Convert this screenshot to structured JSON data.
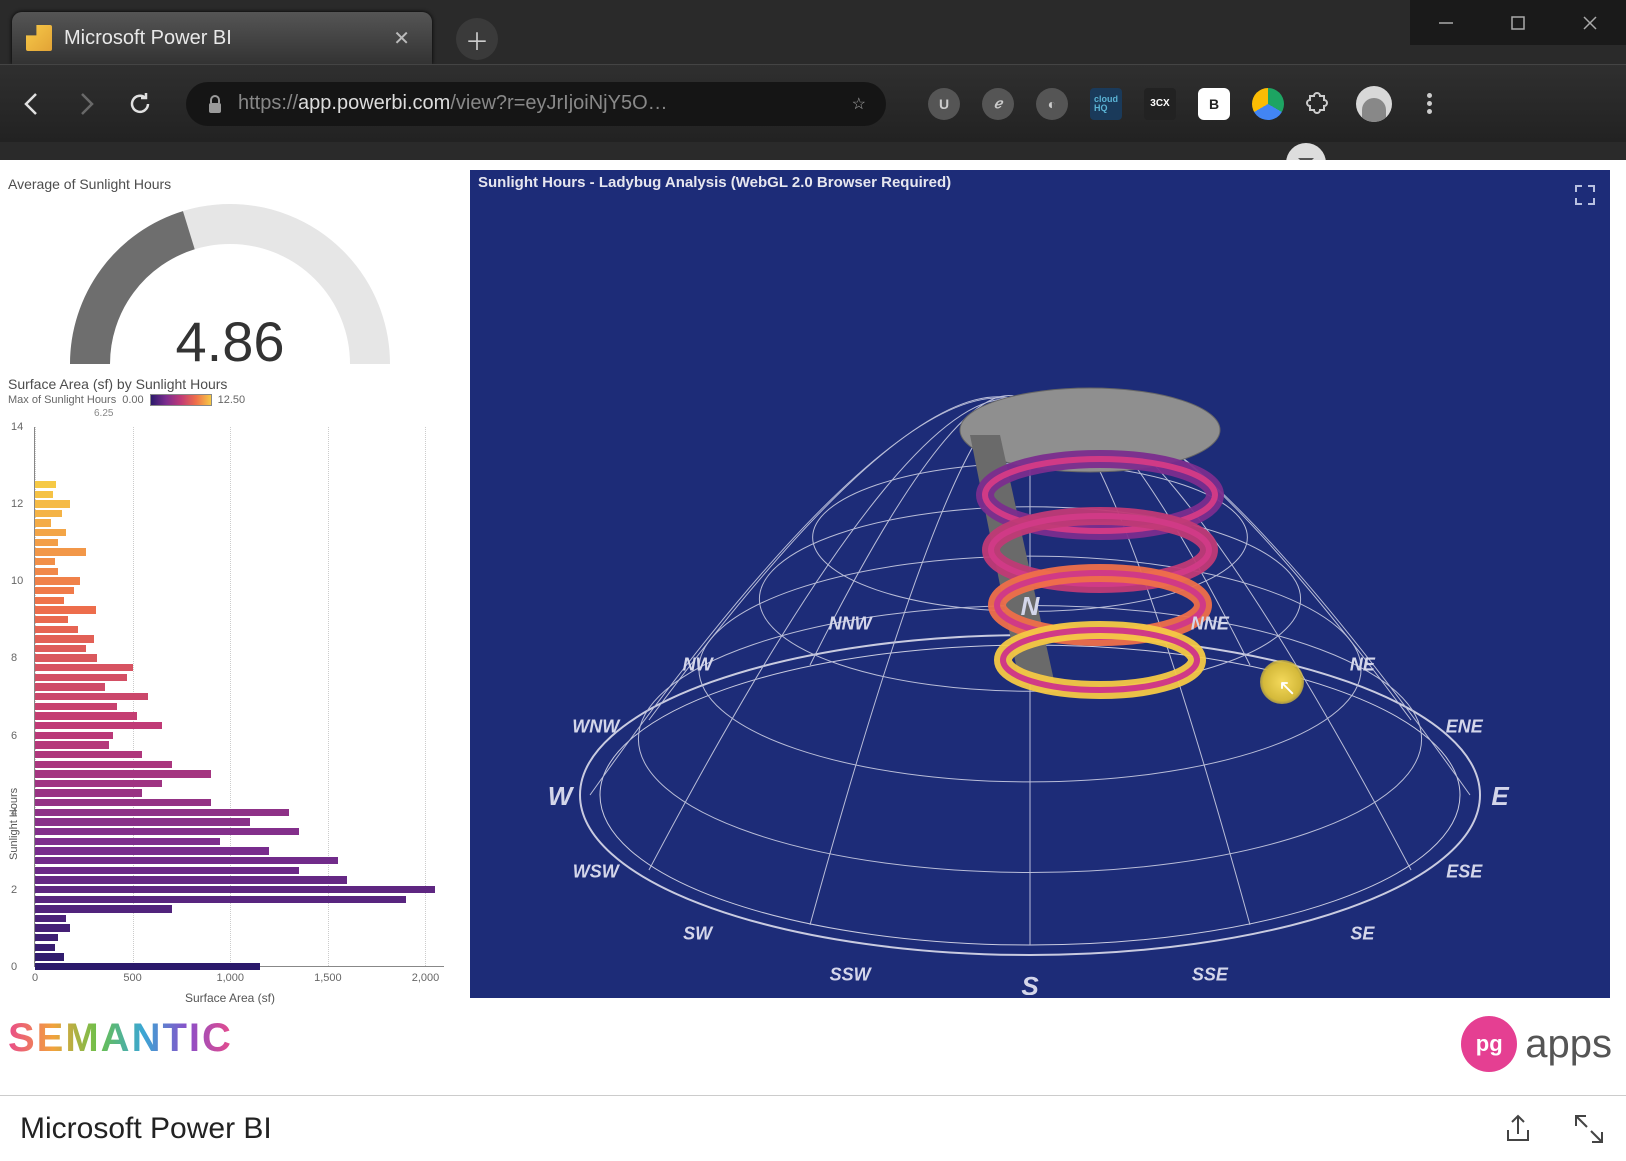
{
  "browser": {
    "tab_title": "Microsoft Power BI",
    "url_display_https": "https://",
    "url_display_host": "app.powerbi.com",
    "url_display_path": "/view?r=eyJrIjoiNjY5O…"
  },
  "gauge": {
    "title": "Average of Sunlight Hours",
    "value": "4.86",
    "min": "0.00",
    "max": "12.00",
    "value_num": 4.86,
    "min_num": 0,
    "max_num": 12
  },
  "barChart": {
    "title": "Surface Area (sf) by Sunlight Hours",
    "legend_label": "Max of Sunlight Hours",
    "legend_min": "0.00",
    "legend_mid": "6.25",
    "legend_max": "12.50",
    "y_axis_label": "Sunlight Hours",
    "x_axis_label": "Surface Area (sf)",
    "y_ticks": [
      0,
      2,
      4,
      6,
      8,
      10,
      12,
      14
    ],
    "x_ticks": [
      0,
      500,
      1000,
      1500,
      2000
    ],
    "x_tick_labels": [
      "0",
      "500",
      "1,000",
      "1,500",
      "2,000"
    ],
    "x_max": 2100
  },
  "chart_data": {
    "type": "bar",
    "orientation": "horizontal",
    "title": "Surface Area (sf) by Sunlight Hours",
    "xlabel": "Surface Area (sf)",
    "ylabel": "Sunlight Hours",
    "xlim": [
      0,
      2100
    ],
    "ylim": [
      0,
      14
    ],
    "color_scale": {
      "field": "Max of Sunlight Hours",
      "min": 0.0,
      "mid": 6.25,
      "max": 12.5,
      "stops": [
        "#2b1a6b",
        "#7b2d8e",
        "#c03a76",
        "#ef6f4a",
        "#f6c945"
      ]
    },
    "series": [
      {
        "name": "Surface Area (sf)",
        "points": [
          {
            "y": 0.0,
            "x": 1150,
            "c": 0.0
          },
          {
            "y": 0.25,
            "x": 150,
            "c": 0.25
          },
          {
            "y": 0.5,
            "x": 100,
            "c": 0.5
          },
          {
            "y": 0.75,
            "x": 120,
            "c": 0.75
          },
          {
            "y": 1.0,
            "x": 180,
            "c": 1.0
          },
          {
            "y": 1.25,
            "x": 160,
            "c": 1.25
          },
          {
            "y": 1.5,
            "x": 700,
            "c": 1.5
          },
          {
            "y": 1.75,
            "x": 1900,
            "c": 1.75
          },
          {
            "y": 2.0,
            "x": 2050,
            "c": 2.0
          },
          {
            "y": 2.25,
            "x": 1600,
            "c": 2.25
          },
          {
            "y": 2.5,
            "x": 1350,
            "c": 2.5
          },
          {
            "y": 2.75,
            "x": 1550,
            "c": 2.75
          },
          {
            "y": 3.0,
            "x": 1200,
            "c": 3.0
          },
          {
            "y": 3.25,
            "x": 950,
            "c": 3.25
          },
          {
            "y": 3.5,
            "x": 1350,
            "c": 3.5
          },
          {
            "y": 3.75,
            "x": 1100,
            "c": 3.75
          },
          {
            "y": 4.0,
            "x": 1300,
            "c": 4.0
          },
          {
            "y": 4.25,
            "x": 900,
            "c": 4.25
          },
          {
            "y": 4.5,
            "x": 550,
            "c": 4.5
          },
          {
            "y": 4.75,
            "x": 650,
            "c": 4.75
          },
          {
            "y": 5.0,
            "x": 900,
            "c": 5.0
          },
          {
            "y": 5.25,
            "x": 700,
            "c": 5.25
          },
          {
            "y": 5.5,
            "x": 550,
            "c": 5.5
          },
          {
            "y": 5.75,
            "x": 380,
            "c": 5.75
          },
          {
            "y": 6.0,
            "x": 400,
            "c": 6.0
          },
          {
            "y": 6.25,
            "x": 650,
            "c": 6.25
          },
          {
            "y": 6.5,
            "x": 520,
            "c": 6.5
          },
          {
            "y": 6.75,
            "x": 420,
            "c": 6.75
          },
          {
            "y": 7.0,
            "x": 580,
            "c": 7.0
          },
          {
            "y": 7.25,
            "x": 360,
            "c": 7.25
          },
          {
            "y": 7.5,
            "x": 470,
            "c": 7.5
          },
          {
            "y": 7.75,
            "x": 500,
            "c": 7.75
          },
          {
            "y": 8.0,
            "x": 320,
            "c": 8.0
          },
          {
            "y": 8.25,
            "x": 260,
            "c": 8.25
          },
          {
            "y": 8.5,
            "x": 300,
            "c": 8.5
          },
          {
            "y": 8.75,
            "x": 220,
            "c": 8.75
          },
          {
            "y": 9.0,
            "x": 170,
            "c": 9.0
          },
          {
            "y": 9.25,
            "x": 310,
            "c": 9.25
          },
          {
            "y": 9.5,
            "x": 150,
            "c": 9.5
          },
          {
            "y": 9.75,
            "x": 200,
            "c": 9.75
          },
          {
            "y": 10.0,
            "x": 230,
            "c": 10.0
          },
          {
            "y": 10.25,
            "x": 120,
            "c": 10.25
          },
          {
            "y": 10.5,
            "x": 100,
            "c": 10.5
          },
          {
            "y": 10.75,
            "x": 260,
            "c": 10.75
          },
          {
            "y": 11.0,
            "x": 120,
            "c": 11.0
          },
          {
            "y": 11.25,
            "x": 160,
            "c": 11.25
          },
          {
            "y": 11.5,
            "x": 80,
            "c": 11.5
          },
          {
            "y": 11.75,
            "x": 140,
            "c": 11.75
          },
          {
            "y": 12.0,
            "x": 180,
            "c": 12.0
          },
          {
            "y": 12.25,
            "x": 90,
            "c": 12.25
          },
          {
            "y": 12.5,
            "x": 110,
            "c": 12.5
          }
        ]
      }
    ]
  },
  "viz3d": {
    "title": "Sunlight Hours - Ladybug Analysis (WebGL 2.0 Browser Required)",
    "compass": [
      "N",
      "NNE",
      "NE",
      "ENE",
      "E",
      "ESE",
      "SE",
      "SSE",
      "S",
      "SSW",
      "SW",
      "WSW",
      "W",
      "WNW",
      "NW",
      "NNW"
    ]
  },
  "footer": {
    "semantic": "SEMANTIC",
    "pg": "pg",
    "apps": "apps"
  },
  "statusbar": {
    "label": "Microsoft Power BI"
  }
}
